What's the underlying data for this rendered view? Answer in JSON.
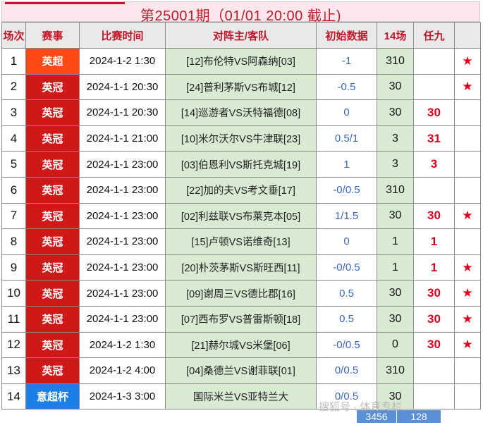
{
  "header": {
    "title": "第25001期（01/01 20:00 截止)"
  },
  "colors": {
    "title_red": "#c0182a",
    "yingchao": "#ff4a16",
    "yingguan": "#cf1919",
    "yichaobei": "#1b7fe8",
    "match_bg": "#d9ead3",
    "odds_blue": "#3a66b8",
    "footer_blue": "#5b8fd6"
  },
  "table": {
    "columns": [
      "场次",
      "赛事",
      "比赛时间",
      "对阵主/客队",
      "初始数据",
      "14场",
      "任九",
      ""
    ],
    "rows": [
      {
        "no": "1",
        "league": "英超",
        "league_color": "#ff4a16",
        "time": "2024-1-2 1:30",
        "match": "[12]布伦特VS阿森纳[03]",
        "odds": "-1",
        "c14": "310",
        "r9": "",
        "star": "★"
      },
      {
        "no": "2",
        "league": "英冠",
        "league_color": "#cf1919",
        "time": "2024-1-1 20:30",
        "match": "[24]普利茅斯VS布城[12]",
        "odds": "-0.5",
        "c14": "30",
        "r9": "",
        "star": "★"
      },
      {
        "no": "3",
        "league": "英冠",
        "league_color": "#cf1919",
        "time": "2024-1-1 20:30",
        "match": "[14]巡游者VS沃特福德[08]",
        "odds": "0",
        "c14": "30",
        "r9": "30",
        "star": ""
      },
      {
        "no": "4",
        "league": "英冠",
        "league_color": "#cf1919",
        "time": "2024-1-1 21:00",
        "match": "[10]米尔沃尔VS牛津联[23]",
        "odds": "0.5/1",
        "c14": "3",
        "r9": "31",
        "star": ""
      },
      {
        "no": "5",
        "league": "英冠",
        "league_color": "#cf1919",
        "time": "2024-1-1 23:00",
        "match": "[03]伯恩利VS斯托克城[19]",
        "odds": "1",
        "c14": "3",
        "r9": "3",
        "star": ""
      },
      {
        "no": "6",
        "league": "英冠",
        "league_color": "#cf1919",
        "time": "2024-1-1 23:00",
        "match": "[22]加的夫VS考文垂[17]",
        "odds": "-0/0.5",
        "c14": "310",
        "r9": "",
        "star": ""
      },
      {
        "no": "7",
        "league": "英冠",
        "league_color": "#cf1919",
        "time": "2024-1-1 23:00",
        "match": "[02]利兹联VS布莱克本[05]",
        "odds": "1/1.5",
        "c14": "30",
        "r9": "30",
        "star": "★"
      },
      {
        "no": "8",
        "league": "英冠",
        "league_color": "#cf1919",
        "time": "2024-1-1 23:00",
        "match": "[15]卢顿VS诺维奇[13]",
        "odds": "0",
        "c14": "1",
        "r9": "1",
        "star": ""
      },
      {
        "no": "9",
        "league": "英冠",
        "league_color": "#cf1919",
        "time": "2024-1-1 23:00",
        "match": "[20]朴茨茅斯VS斯旺西[11]",
        "odds": "-0/0.5",
        "c14": "1",
        "r9": "1",
        "star": "★"
      },
      {
        "no": "10",
        "league": "英冠",
        "league_color": "#cf1919",
        "time": "2024-1-1 23:00",
        "match": "[09]谢周三VS德比郡[16]",
        "odds": "0.5",
        "c14": "30",
        "r9": "30",
        "star": "★"
      },
      {
        "no": "11",
        "league": "英冠",
        "league_color": "#cf1919",
        "time": "2024-1-1 23:00",
        "match": "[07]西布罗VS普雷斯顿[18]",
        "odds": "0.5",
        "c14": "30",
        "r9": "30",
        "star": "★"
      },
      {
        "no": "12",
        "league": "英冠",
        "league_color": "#cf1919",
        "time": "2024-1-2 1:30",
        "match": "[21]赫尔城VS米堡[06]",
        "odds": "-0/0.5",
        "c14": "0",
        "r9": "30",
        "star": "★"
      },
      {
        "no": "13",
        "league": "英冠",
        "league_color": "#cf1919",
        "time": "2024-1-2 4:00",
        "match": "[04]桑德兰VS谢菲联[01]",
        "odds": "0/0.5",
        "c14": "310",
        "r9": "",
        "star": ""
      },
      {
        "no": "14",
        "league": "意超杯",
        "league_color": "#1b7fe8",
        "time": "2024-1-3 3:00",
        "match": "国际米兰VS亚特兰大",
        "odds": "0/0.5",
        "c14": "30",
        "r9": "",
        "star": ""
      }
    ]
  },
  "footer": {
    "combos_14": "3456",
    "combos_r9": "128"
  },
  "watermark": "搜狐号 · 体育专栏"
}
